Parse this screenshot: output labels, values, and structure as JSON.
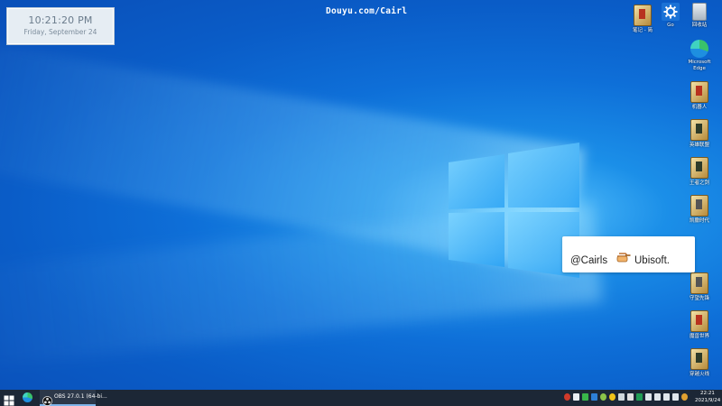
{
  "clock_widget": {
    "time": "10:21:20 PM",
    "date": "Friday, September 24"
  },
  "watermark": {
    "text": "Douyu.com/Cairl"
  },
  "desktop_icons": [
    {
      "id": "book-top",
      "label": "笔记 - 简"
    },
    {
      "id": "settings",
      "label": "Go"
    },
    {
      "id": "recycle-bin",
      "label": "回收站"
    },
    {
      "id": "edge",
      "label": "Microsoft Edge"
    },
    {
      "id": "game1",
      "label": "机器人"
    },
    {
      "id": "game2",
      "label": "英雄联盟"
    },
    {
      "id": "game3",
      "label": "王者之剑"
    },
    {
      "id": "game4",
      "label": "凯撒时代"
    },
    {
      "id": "game5",
      "label": "守望先锋"
    },
    {
      "id": "game6",
      "label": "魔兽世界"
    },
    {
      "id": "game7",
      "label": "穿越火线"
    }
  ],
  "overlay": {
    "handle": "@Cairls",
    "brand": "Ubisoft."
  },
  "taskbar": {
    "obs_label": "OBS 27.0.1 (64-bi...",
    "clock_time": "22:21",
    "clock_date": "2021/9/24"
  },
  "colors": {
    "desktop_accent": "#0e6fd8",
    "taskbar_bg": "#1c2736",
    "obs_underline": "#7eb4ea"
  }
}
